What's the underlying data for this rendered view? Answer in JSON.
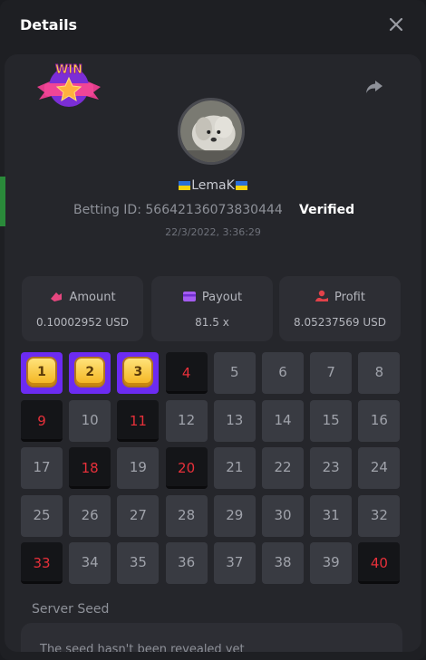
{
  "header": {
    "title": "Details"
  },
  "profile": {
    "username": "LemaK",
    "betting_id_label": "Betting ID:",
    "betting_id": "56642136073830444",
    "verified_label": "Verified",
    "date": "22/3/2022, 3:36:29",
    "badge_text": "WIN"
  },
  "stats": [
    {
      "label": "Amount",
      "value": "0.10002952 USD",
      "icon": "amount-icon"
    },
    {
      "label": "Payout",
      "value": "81.5 x",
      "icon": "wallet-icon"
    },
    {
      "label": "Profit",
      "value": "8.05237569 USD",
      "icon": "profit-icon"
    }
  ],
  "board": {
    "numbers": [
      1,
      2,
      3,
      4,
      5,
      6,
      7,
      8,
      9,
      10,
      11,
      12,
      13,
      14,
      15,
      16,
      17,
      18,
      19,
      20,
      21,
      22,
      23,
      24,
      25,
      26,
      27,
      28,
      29,
      30,
      31,
      32,
      33,
      34,
      35,
      36,
      37,
      38,
      39,
      40
    ],
    "picked": [
      1,
      2,
      3
    ],
    "drawn": [
      4,
      9,
      11,
      18,
      20,
      33,
      40
    ]
  },
  "seed": {
    "label": "Server Seed",
    "text": "The seed hasn't been revealed yet"
  },
  "colors": {
    "accent_purple": "#6c2bf2",
    "drawn_red": "#e8303a",
    "panel": "#25262b"
  }
}
